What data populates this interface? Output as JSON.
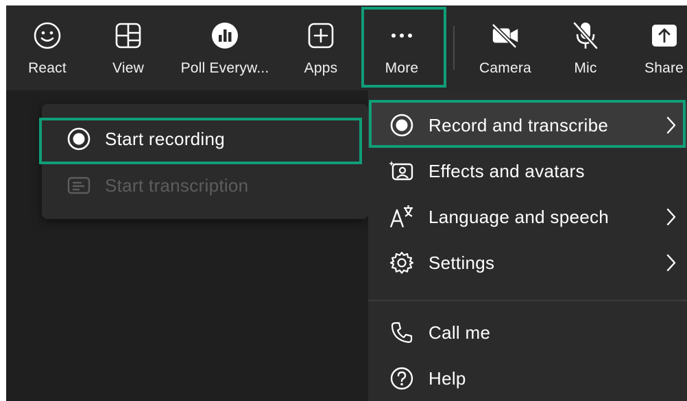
{
  "toolbar": {
    "buttons": [
      {
        "label": "React",
        "icon": "smiley-icon"
      },
      {
        "label": "View",
        "icon": "layout-grid-icon"
      },
      {
        "label": "Poll Everyw...",
        "icon": "poll-everywhere-icon"
      },
      {
        "label": "Apps",
        "icon": "add-app-icon"
      },
      {
        "label": "More",
        "icon": "more-dots-icon"
      },
      {
        "label": "Camera",
        "icon": "camera-off-icon"
      },
      {
        "label": "Mic",
        "icon": "mic-off-icon"
      },
      {
        "label": "Share",
        "icon": "share-icon"
      }
    ]
  },
  "more_menu": {
    "items": [
      {
        "label": "Record and transcribe",
        "icon": "record-icon",
        "has_submenu": true
      },
      {
        "label": "Effects and avatars",
        "icon": "effects-icon",
        "has_submenu": false
      },
      {
        "label": "Language and speech",
        "icon": "language-icon",
        "has_submenu": true
      },
      {
        "label": "Settings",
        "icon": "gear-icon",
        "has_submenu": true
      },
      {
        "label": "Call me",
        "icon": "phone-icon",
        "has_submenu": false
      },
      {
        "label": "Help",
        "icon": "help-icon",
        "has_submenu": false
      }
    ]
  },
  "record_submenu": {
    "items": [
      {
        "label": "Start recording",
        "icon": "record-icon",
        "enabled": true
      },
      {
        "label": "Start transcription",
        "icon": "transcript-icon",
        "enabled": false
      }
    ]
  },
  "colors": {
    "highlight": "#0f9e78",
    "toolbar_bg": "#292929",
    "menu_bg": "#2b2b2b",
    "disabled_text": "#5d5d5d"
  }
}
